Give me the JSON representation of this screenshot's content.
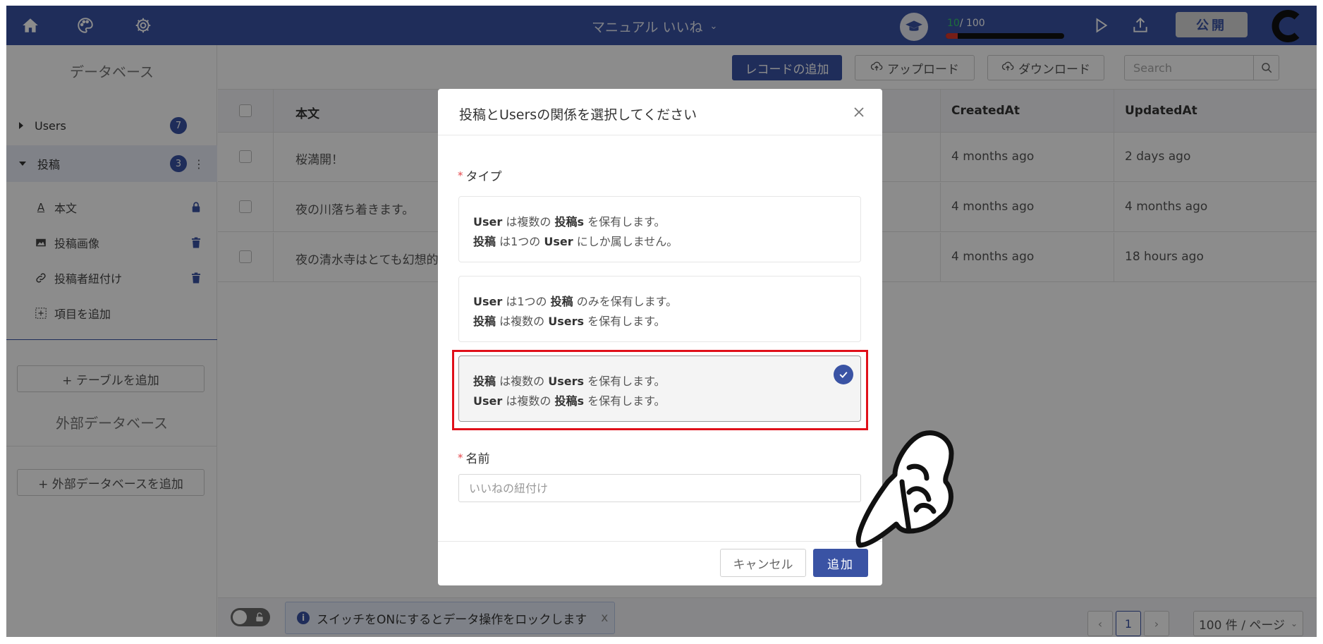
{
  "topbar": {
    "title": "マニュアル いいね",
    "progress_current": "10",
    "progress_total": "/ 100",
    "progress_fraction": 0.1,
    "publish_label": "公開"
  },
  "sidebar": {
    "db_title": "データベース",
    "tables": [
      {
        "name": "Users",
        "count": "7"
      },
      {
        "name": "投稿",
        "count": "3"
      }
    ],
    "fields": [
      {
        "label": "本文",
        "icon": "text-icon",
        "right_icon": "lock-icon"
      },
      {
        "label": "投稿画像",
        "icon": "image-icon",
        "right_icon": "trash-icon"
      },
      {
        "label": "投稿者紐付け",
        "icon": "link-icon",
        "right_icon": "trash-icon"
      },
      {
        "label": "項目を追加",
        "icon": "add-field-icon"
      }
    ],
    "add_table_label": "+ テーブルを追加",
    "ext_db_title": "外部データベース",
    "add_ext_db_label": "+ 外部データベースを追加"
  },
  "toolbar": {
    "add_record_label": "レコードの追加",
    "upload_label": "アップロード",
    "download_label": "ダウンロード",
    "search_placeholder": "Search"
  },
  "table": {
    "columns": [
      "本文",
      "CreatedAt",
      "UpdatedAt"
    ],
    "rows": [
      {
        "body": "桜満開！",
        "created": "4 months ago",
        "updated": "2 days ago"
      },
      {
        "body": "夜の川落ち着きます。",
        "created": "4 months ago",
        "updated": "4 months ago"
      },
      {
        "body": "夜の清水寺はとても幻想的で",
        "created": "4 months ago",
        "updated": "18 hours ago"
      }
    ]
  },
  "footer": {
    "lock_notice": "スイッチをONにするとデータ操作をロックします",
    "lock_notice_close": "x",
    "page_current": "1",
    "page_size": "100 件 / ページ"
  },
  "modal": {
    "title": "投稿とUsersの関係を選択してください",
    "type_label": "タイプ",
    "options": [
      {
        "l1_a": "User",
        "l1_b": " は複数の ",
        "l1_c": "投稿s",
        "l1_d": " を保有します。",
        "l2_a": "投稿",
        "l2_b": " は1つの ",
        "l2_c": "User",
        "l2_d": " にしか属しません。"
      },
      {
        "l1_a": "User",
        "l1_b": " は1つの ",
        "l1_c": "投稿",
        "l1_d": " のみを保有します。",
        "l2_a": "投稿",
        "l2_b": " は複数の ",
        "l2_c": "Users",
        "l2_d": " を保有します。"
      },
      {
        "l1_a": "投稿",
        "l1_b": " は複数の ",
        "l1_c": "Users",
        "l1_d": " を保有します。",
        "l2_a": "User",
        "l2_b": " は複数の ",
        "l2_c": "投稿s",
        "l2_d": " を保有します。"
      }
    ],
    "selected_option": 3,
    "name_label": "名前",
    "name_placeholder": "いいねの紐付け",
    "cancel_label": "キャンセル",
    "add_label": "追加"
  },
  "colors": {
    "primary": "#3a53a4",
    "highlight": "#e0101a",
    "progress_fill": "#d9372b",
    "progress_text": "#35c96b"
  }
}
